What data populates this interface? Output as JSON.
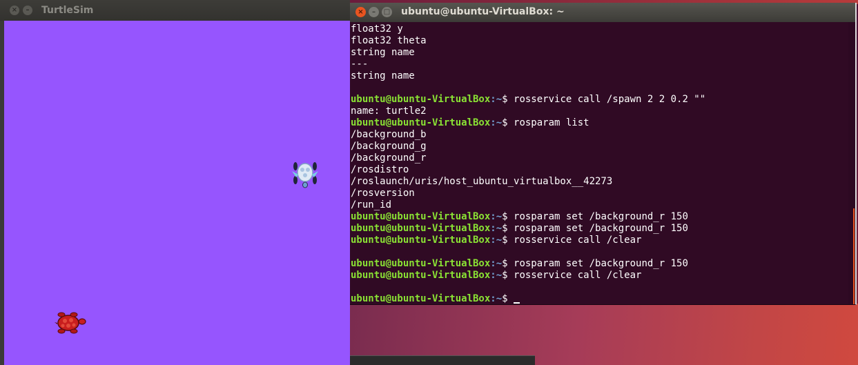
{
  "turtlesim": {
    "title": "TurtleSim",
    "background_color": "#9655fe"
  },
  "terminal": {
    "title": "ubuntu@ubuntu-VirtualBox: ~",
    "prompt_user": "ubuntu@ubuntu-VirtualBox",
    "prompt_path": ":~",
    "prompt_symbol": "$ ",
    "lines": [
      {
        "kind": "output",
        "text": "float32 y"
      },
      {
        "kind": "output",
        "text": "float32 theta"
      },
      {
        "kind": "output",
        "text": "string name"
      },
      {
        "kind": "output",
        "text": "---"
      },
      {
        "kind": "output",
        "text": "string name"
      },
      {
        "kind": "output",
        "text": ""
      },
      {
        "kind": "command",
        "text": "rosservice call /spawn 2 2 0.2 \"\""
      },
      {
        "kind": "output",
        "text": "name: turtle2"
      },
      {
        "kind": "command",
        "text": "rosparam list"
      },
      {
        "kind": "output",
        "text": "/background_b"
      },
      {
        "kind": "output",
        "text": "/background_g"
      },
      {
        "kind": "output",
        "text": "/background_r"
      },
      {
        "kind": "output",
        "text": "/rosdistro"
      },
      {
        "kind": "output",
        "text": "/roslaunch/uris/host_ubuntu_virtualbox__42273"
      },
      {
        "kind": "output",
        "text": "/rosversion"
      },
      {
        "kind": "output",
        "text": "/run_id"
      },
      {
        "kind": "command",
        "text": "rosparam set /background_r 150"
      },
      {
        "kind": "command",
        "text": "rosparam set /background_r 150"
      },
      {
        "kind": "command",
        "text": "rosservice call /clear"
      },
      {
        "kind": "output",
        "text": ""
      },
      {
        "kind": "command",
        "text": "rosparam set /background_r 150"
      },
      {
        "kind": "command",
        "text": "rosservice call /clear"
      },
      {
        "kind": "output",
        "text": ""
      },
      {
        "kind": "prompt",
        "text": ""
      }
    ],
    "colors": {
      "background": "#300a24",
      "prompt_user": "#8ae234",
      "prompt_path": "#729fcf",
      "close_button": "#e95420"
    }
  },
  "icons": {
    "close": "close-icon",
    "minimize": "minimize-icon",
    "maximize": "maximize-icon"
  }
}
